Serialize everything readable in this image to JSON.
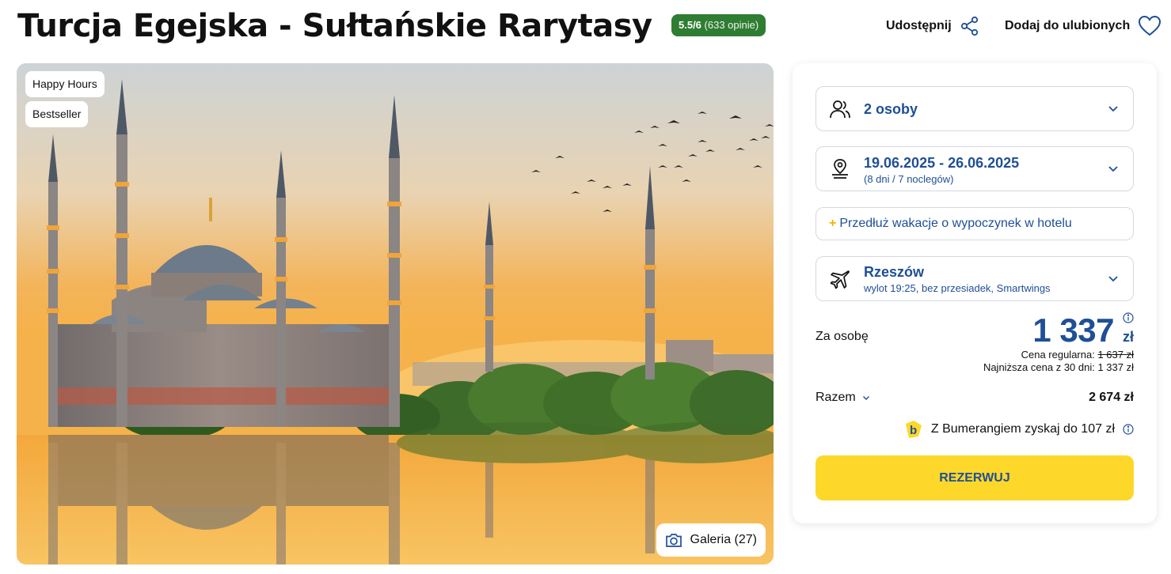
{
  "header": {
    "title": "Turcja Egejska - Sułtańskie Rarytasy",
    "rating_score": "5.5/6",
    "rating_count": "(633 opinie)",
    "share_label": "Udostępnij",
    "favorite_label": "Dodaj do ulubionych"
  },
  "hero": {
    "badges": [
      "Happy Hours",
      "Bestseller"
    ],
    "gallery_label": "Galeria (27)"
  },
  "booking": {
    "persons": "2 osoby",
    "dates": "19.06.2025 - 26.06.2025",
    "dates_sub": "(8 dni / 7 noclegów)",
    "extend_label": "Przedłuż wakacje o wypoczynek w hotelu",
    "departure_city": "Rzeszów",
    "flight_details": "wylot 19:25, bez przesiadek, Smartwings",
    "per_person_label": "Za osobę",
    "price": "1 337",
    "currency": "zł",
    "regular_price_label": "Cena regularna:",
    "regular_price": "1 637 zł",
    "lowest_price_label": "Najniższa cena z 30 dni: 1 337 zł",
    "total_label": "Razem",
    "total_value": "2 674 zł",
    "bumerang_text": "Z Bumerangiem zyskaj do 107 zł",
    "book_button": "REZERWUJ"
  },
  "colors": {
    "accent_blue": "#1f4f96",
    "rating_green": "#2f7d32",
    "cta_yellow": "#fdd82a"
  },
  "icons": [
    "share-icon",
    "heart-icon",
    "people-icon",
    "calendar-pin-icon",
    "plane-icon",
    "chevron-down-icon",
    "info-icon",
    "camera-icon",
    "bumerang-logo"
  ]
}
